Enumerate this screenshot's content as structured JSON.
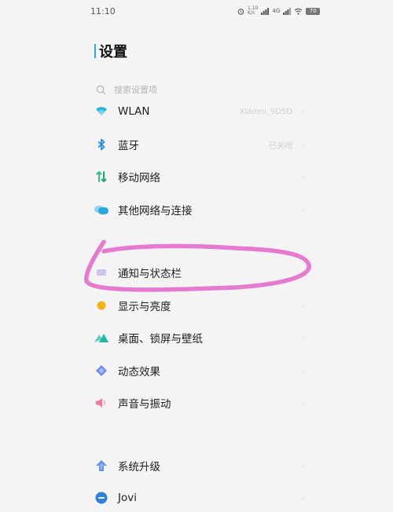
{
  "status_bar": {
    "time": "11:10",
    "net_speed_value": "1.10",
    "net_speed_unit": "K/s",
    "signal_label": "4G",
    "battery": "70"
  },
  "page": {
    "title": "设置"
  },
  "search": {
    "placeholder": "搜索设置项"
  },
  "items": [
    {
      "label": "WLAN",
      "value": "Xiaomi_9D5D",
      "icon": "wifi-icon"
    },
    {
      "label": "蓝牙",
      "value": "已关闭",
      "icon": "bluetooth-icon"
    },
    {
      "label": "移动网络",
      "value": "",
      "icon": "mobile-network-icon"
    },
    {
      "label": "其他网络与连接",
      "value": "",
      "icon": "other-connections-icon"
    },
    {
      "label": "通知与状态栏",
      "value": "",
      "icon": "notification-icon"
    },
    {
      "label": "显示与亮度",
      "value": "",
      "icon": "brightness-icon"
    },
    {
      "label": "桌面、锁屏与壁纸",
      "value": "",
      "icon": "wallpaper-icon"
    },
    {
      "label": "动态效果",
      "value": "",
      "icon": "animation-icon"
    },
    {
      "label": "声音与振动",
      "value": "",
      "icon": "sound-icon"
    },
    {
      "label": "系统升级",
      "value": "",
      "icon": "system-update-icon"
    },
    {
      "label": "Jovi",
      "value": "",
      "icon": "jovi-icon"
    }
  ],
  "chevron": "›",
  "colors": {
    "accent": "#2aa9e0",
    "highlight_stroke": "#e573cf",
    "background": "#f4f4f4"
  }
}
